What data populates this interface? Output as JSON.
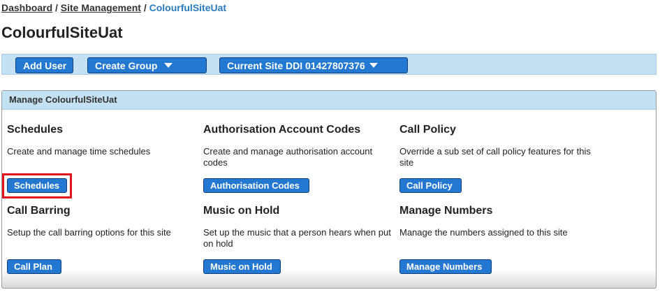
{
  "breadcrumb": {
    "items": [
      "Dashboard",
      "Site Management"
    ],
    "separator": "/",
    "current": "ColourfulSiteUat"
  },
  "page": {
    "title": "ColourfulSiteUat"
  },
  "toolbar": {
    "add_user": "Add User",
    "create_group": "Create Group",
    "current_site": "Current Site DDI 01427807376"
  },
  "panel": {
    "title": "Manage ColourfulSiteUat",
    "cards": [
      {
        "title": "Schedules",
        "description": "Create and manage time schedules",
        "button": "Schedules"
      },
      {
        "title": "Authorisation Account Codes",
        "description": "Create and manage authorisation account codes",
        "button": "Authorisation Codes"
      },
      {
        "title": "Call Policy",
        "description": "Override a sub set of call policy features for this site",
        "button": "Call Policy"
      },
      {
        "title": "Call Barring",
        "description": "Setup the call barring options for this site",
        "button": "Call Plan"
      },
      {
        "title": "Music on Hold",
        "description": "Set up the music that a person hears when put on hold",
        "button": "Music on Hold"
      },
      {
        "title": "Manage Numbers",
        "description": "Manage the numbers assigned to this site",
        "button": "Manage Numbers"
      }
    ]
  },
  "colors": {
    "accent": "#2379d2",
    "bar": "#c4e0f3",
    "highlight": "#e0141e",
    "link": "#2a7bbf"
  }
}
